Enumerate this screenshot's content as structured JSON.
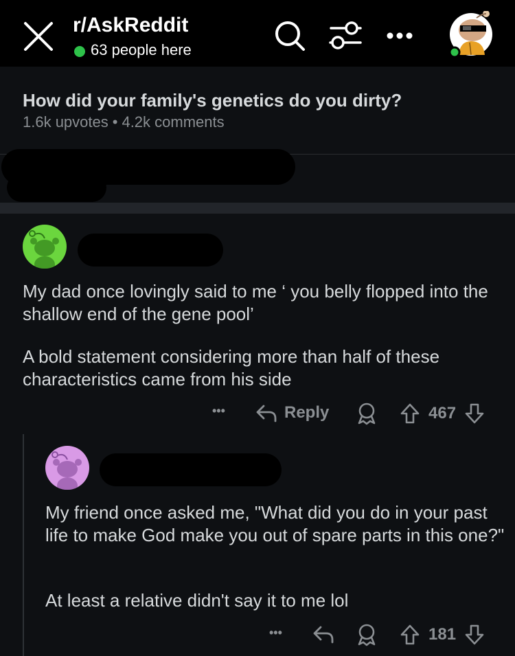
{
  "header": {
    "subreddit": "r/AskReddit",
    "online": "63 people here",
    "colors": {
      "online": "#2ec24a",
      "background": "#000000"
    },
    "icons": [
      "close-icon",
      "search-icon",
      "filter-icon",
      "more-icon",
      "user-avatar"
    ]
  },
  "post": {
    "title": "How did your family's genetics do you dirty?",
    "upvotes": "1.6k upvotes",
    "separator": "•",
    "comments": "4.2k comments"
  },
  "comments": [
    {
      "avatar_color": "#6bd63e",
      "text1": "My dad once lovingly said to me ‘ you belly flopped into the shallow end of the gene pool’",
      "text2": "A bold statement considering more than half of these characteristics came from his side",
      "more_label": "•••",
      "reply_label": "Reply",
      "score": "467"
    },
    {
      "avatar_color": "#d99ae6",
      "text1": "My friend once asked me, \"What did you do in your past life to make God make you out of spare parts in this one?\"",
      "text2": "At least a relative didn't say it to me lol",
      "more_label": "•••",
      "score": "181"
    }
  ]
}
